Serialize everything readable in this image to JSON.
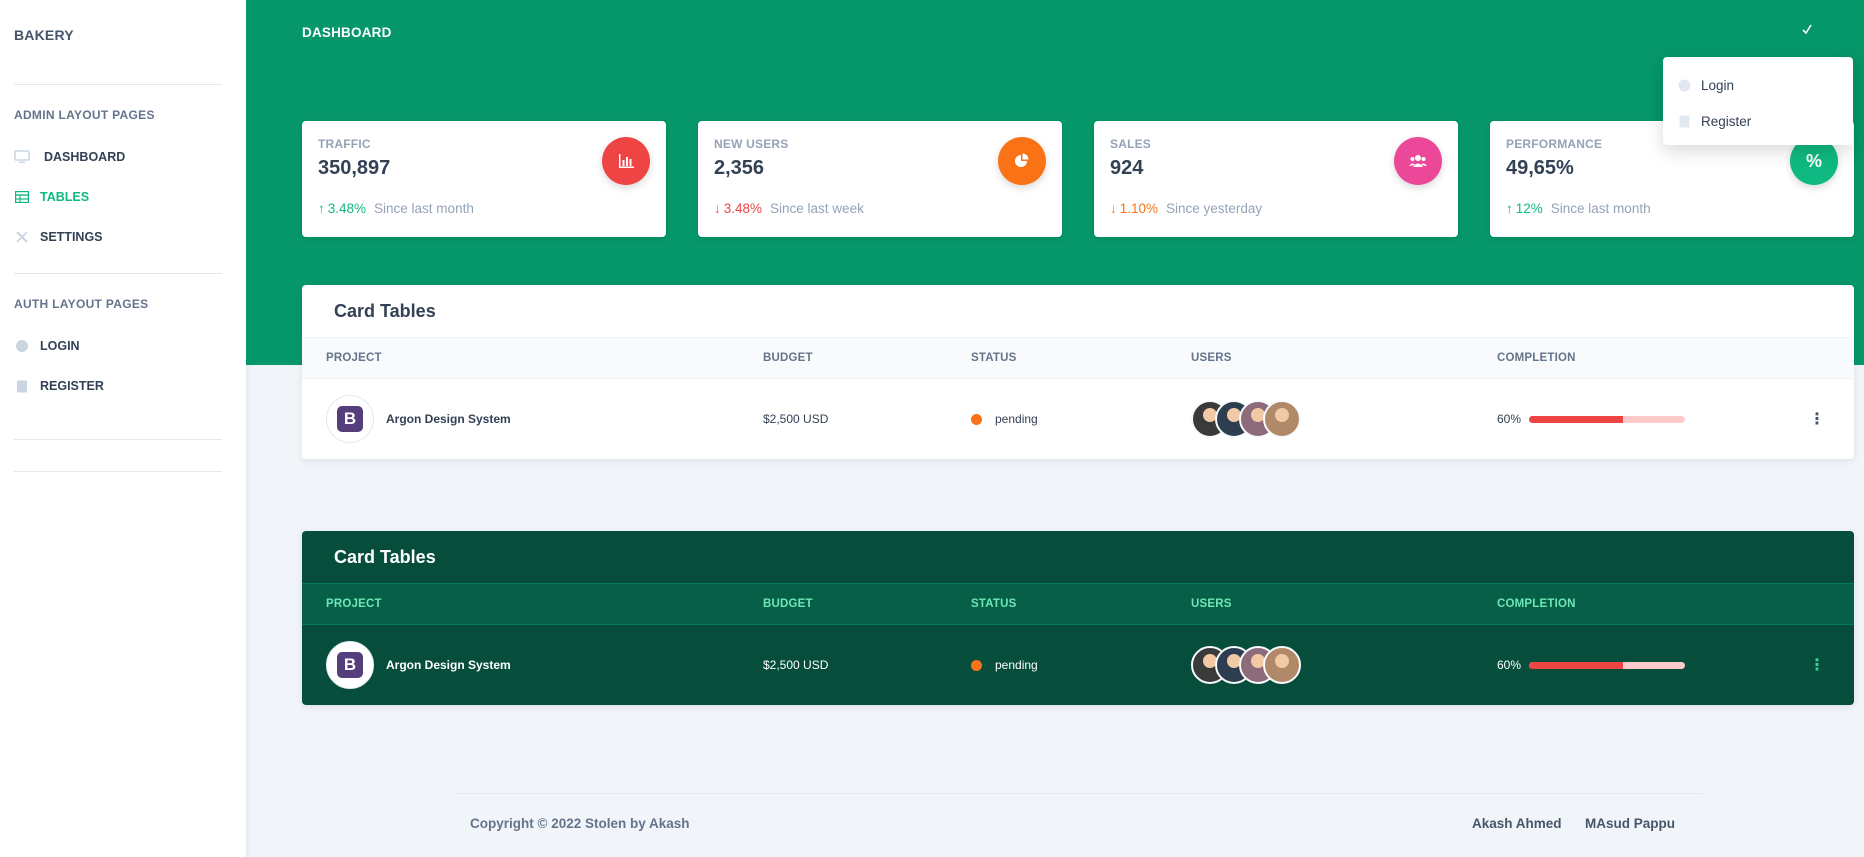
{
  "sidebar": {
    "brand": "BAKERY",
    "admin_heading": "ADMIN LAYOUT PAGES",
    "auth_heading": "AUTH LAYOUT PAGES",
    "items": [
      {
        "label": "DASHBOARD",
        "icon": "monitor-icon"
      },
      {
        "label": "TABLES",
        "icon": "table-icon"
      },
      {
        "label": "SETTINGS",
        "icon": "tools-icon"
      },
      {
        "label": "LOGIN",
        "icon": "fingerprint-icon"
      },
      {
        "label": "REGISTER",
        "icon": "clipboard-icon"
      }
    ]
  },
  "header": {
    "title": "DASHBOARD",
    "dropdown": [
      {
        "label": "Login",
        "icon": "fingerprint-icon"
      },
      {
        "label": "Register",
        "icon": "clipboard-icon"
      }
    ]
  },
  "stats": [
    {
      "label": "TRAFFIC",
      "value": "350,897",
      "percent": "3.48%",
      "since": "Since last month",
      "trend": "up",
      "color": "#ef4444",
      "icon": "bar-chart-icon"
    },
    {
      "label": "NEW USERS",
      "value": "2,356",
      "percent": "3.48%",
      "since": "Since last week",
      "trend": "down",
      "color": "#f97316",
      "icon": "pie-chart-icon"
    },
    {
      "label": "SALES",
      "value": "924",
      "percent": "1.10%",
      "since": "Since yesterday",
      "trend": "down",
      "color": "#ec4899",
      "icon": "users-icon"
    },
    {
      "label": "PERFORMANCE",
      "value": "49,65%",
      "percent": "12%",
      "since": "Since last month",
      "trend": "up",
      "color": "#10b981",
      "icon": "percent-icon"
    }
  ],
  "tables": [
    {
      "title": "Card Tables",
      "headers": [
        "PROJECT",
        "BUDGET",
        "STATUS",
        "USERS",
        "COMPLETION"
      ],
      "rows": [
        {
          "project": "Argon Design System",
          "budget": "$2,500 USD",
          "status": "pending",
          "completion": "60%",
          "completion_value": 0.6
        }
      ]
    },
    {
      "title": "Card Tables",
      "headers": [
        "PROJECT",
        "BUDGET",
        "STATUS",
        "USERS",
        "COMPLETION"
      ],
      "rows": [
        {
          "project": "Argon Design System",
          "budget": "$2,500 USD",
          "status": "pending",
          "completion": "60%",
          "completion_value": 0.6
        }
      ]
    }
  ],
  "footer": {
    "copyright": "Copyright © 2022 Stolen by Akash",
    "links": [
      "Akash Ahmed",
      "MAsud Pappu"
    ]
  },
  "colors": {
    "primary": "#059669",
    "dark_card": "#064e3b",
    "accent": "#10b981"
  }
}
